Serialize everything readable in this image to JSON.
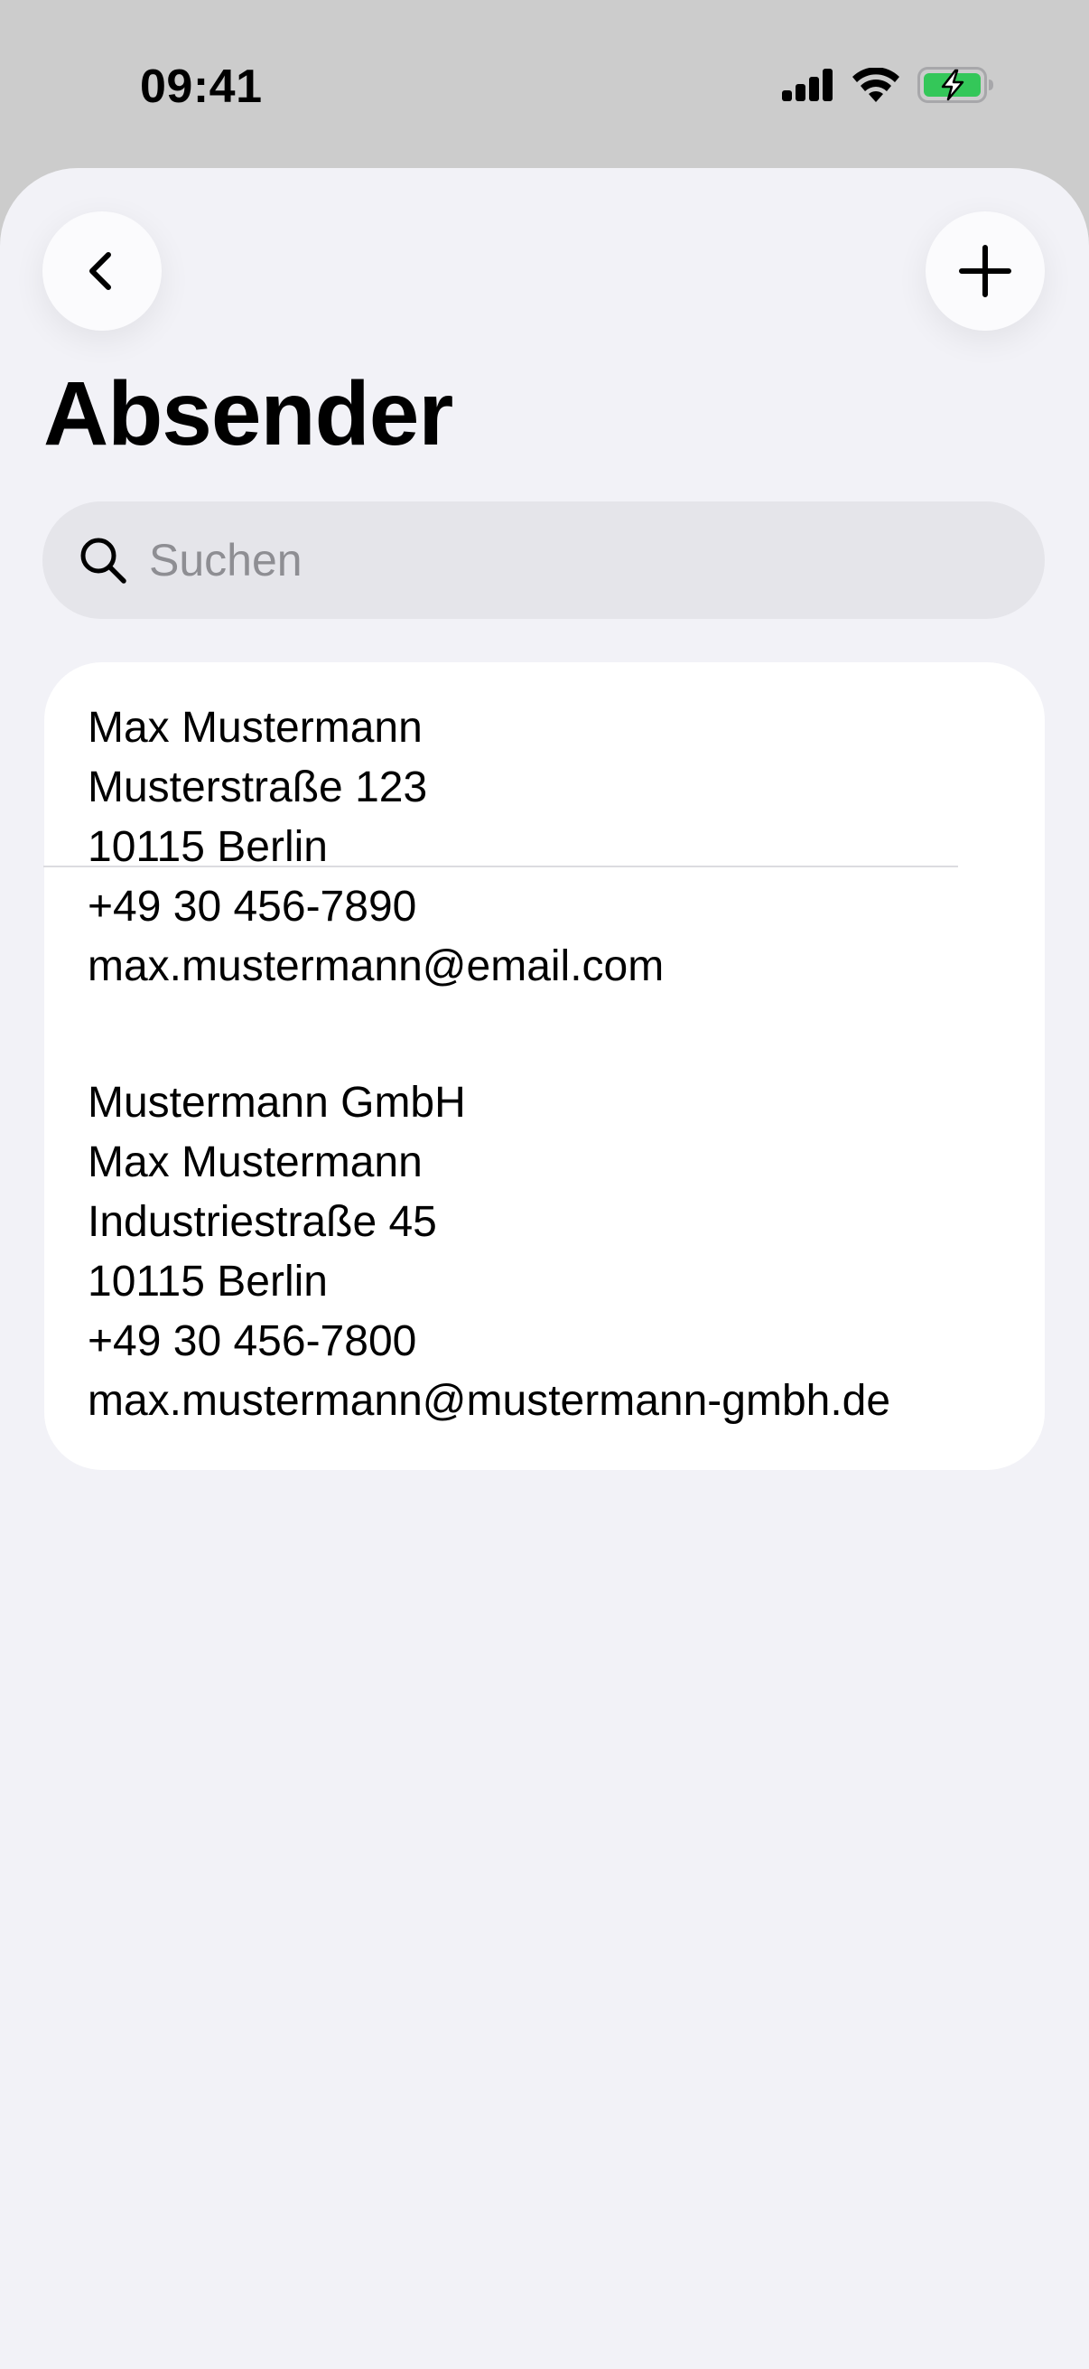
{
  "status_bar": {
    "time": "09:41",
    "signal_icon": "cellular-signal-icon",
    "wifi_icon": "wifi-icon",
    "battery_icon": "battery-charging-icon",
    "battery_color": "#34c759"
  },
  "navigation": {
    "back_icon": "chevron-left-icon",
    "add_icon": "plus-icon",
    "title": "Absender"
  },
  "search": {
    "placeholder": "Suchen",
    "value": "",
    "icon": "search-icon"
  },
  "senders": [
    {
      "lines": [
        "Max Mustermann",
        "Musterstraße 123",
        "10115 Berlin",
        "+49 30 456-7890",
        "max.mustermann@email.com"
      ]
    },
    {
      "lines": [
        "Mustermann GmbH",
        "Max Mustermann",
        "Industriestraße 45",
        "10115 Berlin",
        "+49 30 456-7800",
        "max.mustermann@mustermann-gmbh.de"
      ]
    }
  ],
  "colors": {
    "background": "#f2f2f7",
    "card": "#ffffff",
    "search_field": "#e5e5ea",
    "placeholder": "#8e8e93"
  }
}
